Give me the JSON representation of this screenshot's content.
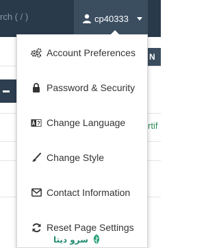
{
  "topbar": {
    "search_text": "rch ( / )",
    "username": "cp40333"
  },
  "background": {
    "right_tab_text": "N",
    "green_text": "rtif"
  },
  "menu": {
    "items": [
      {
        "label": "Account Preferences",
        "icon": "gears-icon"
      },
      {
        "label": "Password & Security",
        "icon": "lock-icon"
      },
      {
        "label": "Change Language",
        "icon": "language-icon"
      },
      {
        "label": "Change Style",
        "icon": "paintbrush-icon"
      },
      {
        "label": "Contact Information",
        "icon": "envelope-icon"
      },
      {
        "label": "Reset Page Settings",
        "icon": "refresh-icon"
      }
    ]
  },
  "watermark": {
    "text": "سرو دیتا"
  }
}
